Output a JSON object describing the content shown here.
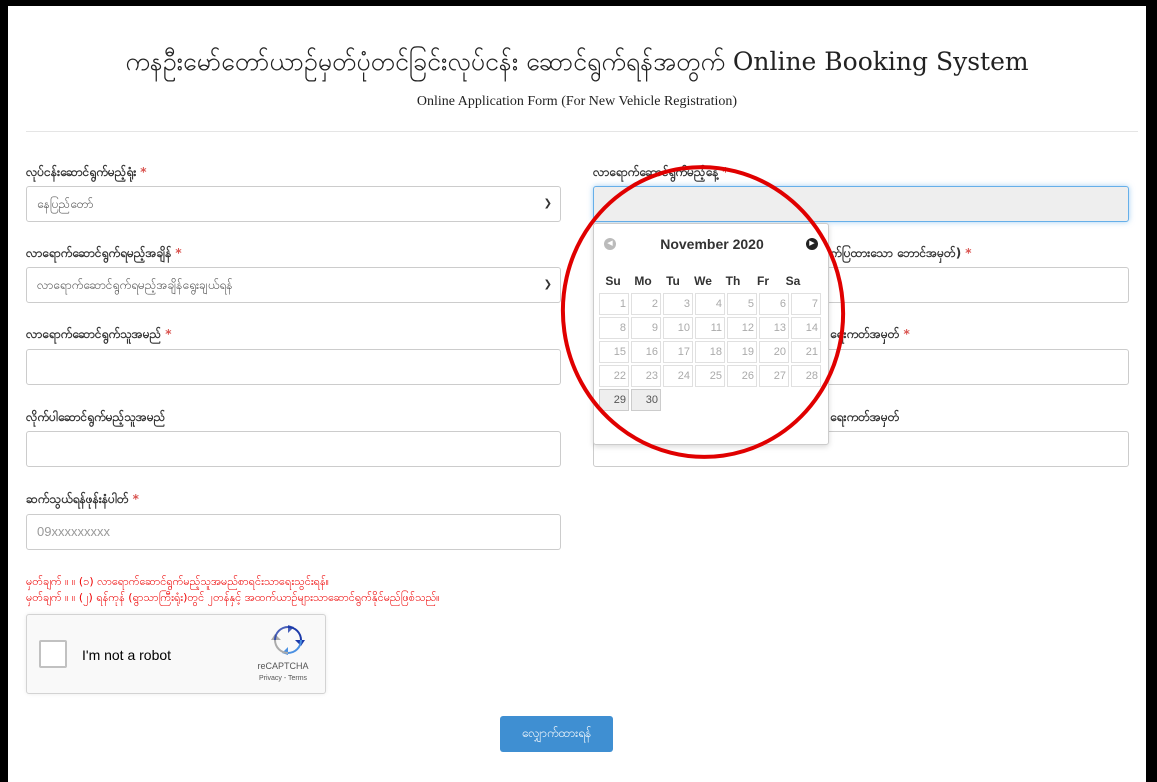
{
  "header": {
    "title": "ကနဦးမော်တော်ယာဉ်မှတ်ပုံတင်ခြင်းလုပ်ငန်း ဆောင်ရွက်ရန်အတွက် Online Booking System",
    "subtitle": "Online Application Form (For New Vehicle Registration)"
  },
  "form": {
    "office": {
      "label": "လုပ်ငန်းဆောင်ရွက်မည့်ရုံး",
      "value": "နေပြည်တော်"
    },
    "visit_date": {
      "label": "လာရောက်ဆောင်ရွက်မည့်နေ့",
      "value": ""
    },
    "visit_time": {
      "label": "လာရောက်ဆောင်ရွက်ရမည့်အချိန်",
      "value": "လာရောက်ဆောင်ရွက်ရမည့်အချိန်ရွေးချယ်ရန်"
    },
    "chassis_no": {
      "label": "က်ပြထားသော ဘောင်အမှတ်)",
      "value": ""
    },
    "applicant_name": {
      "label": "လာရောက်ဆောင်ရွက်သူအမည်",
      "value": ""
    },
    "applicant_nrc": {
      "label": "ရေးကတ်အမှတ်",
      "value": ""
    },
    "companion_name": {
      "label": "လိုက်ပါဆောင်ရွက်မည့်သူအမည်",
      "value": ""
    },
    "companion_nrc": {
      "label": "ရေးကတ်အမှတ်",
      "value": ""
    },
    "phone": {
      "label": "ဆက်သွယ်ရန်ဖုန်းနံပါတ်",
      "placeholder": "09xxxxxxxxx"
    },
    "required_mark": "*"
  },
  "notes": [
    "မှတ်ချက် ။ ။ (၁) လာရောက်ဆောင်ရွက်မည့်သူအမည်စာရင်းသာရေးသွင်းရန်။",
    "မှတ်ချက် ။ ။ (၂) ရန်ကုန် (ရွာသာကြီးရုံး)တွင် ၂တန်နှင့် အထက်ယာဉ်များသာဆောင်ရွက်နိုင်မည်ဖြစ်သည်။"
  ],
  "recaptcha": {
    "text": "I'm not a robot",
    "brand": "reCAPTCHA",
    "links": "Privacy - Terms"
  },
  "submit_label": "လျှောက်ထားရန်",
  "datepicker": {
    "month_label": "November 2020",
    "weekdays": [
      "Su",
      "Mo",
      "Tu",
      "We",
      "Th",
      "Fr",
      "Sa"
    ],
    "weeks": [
      [
        "1",
        "2",
        "3",
        "4",
        "5",
        "6",
        "7"
      ],
      [
        "8",
        "9",
        "10",
        "11",
        "12",
        "13",
        "14"
      ],
      [
        "15",
        "16",
        "17",
        "18",
        "19",
        "20",
        "21"
      ],
      [
        "22",
        "23",
        "24",
        "25",
        "26",
        "27",
        "28"
      ],
      [
        "29",
        "30",
        "",
        "",
        "",
        "",
        ""
      ]
    ],
    "available_days": [
      "29",
      "30"
    ]
  },
  "colors": {
    "required": "#d9534f",
    "note": "#e00000",
    "primary": "#3f8fd2",
    "highlight_circle": "#e00000"
  }
}
